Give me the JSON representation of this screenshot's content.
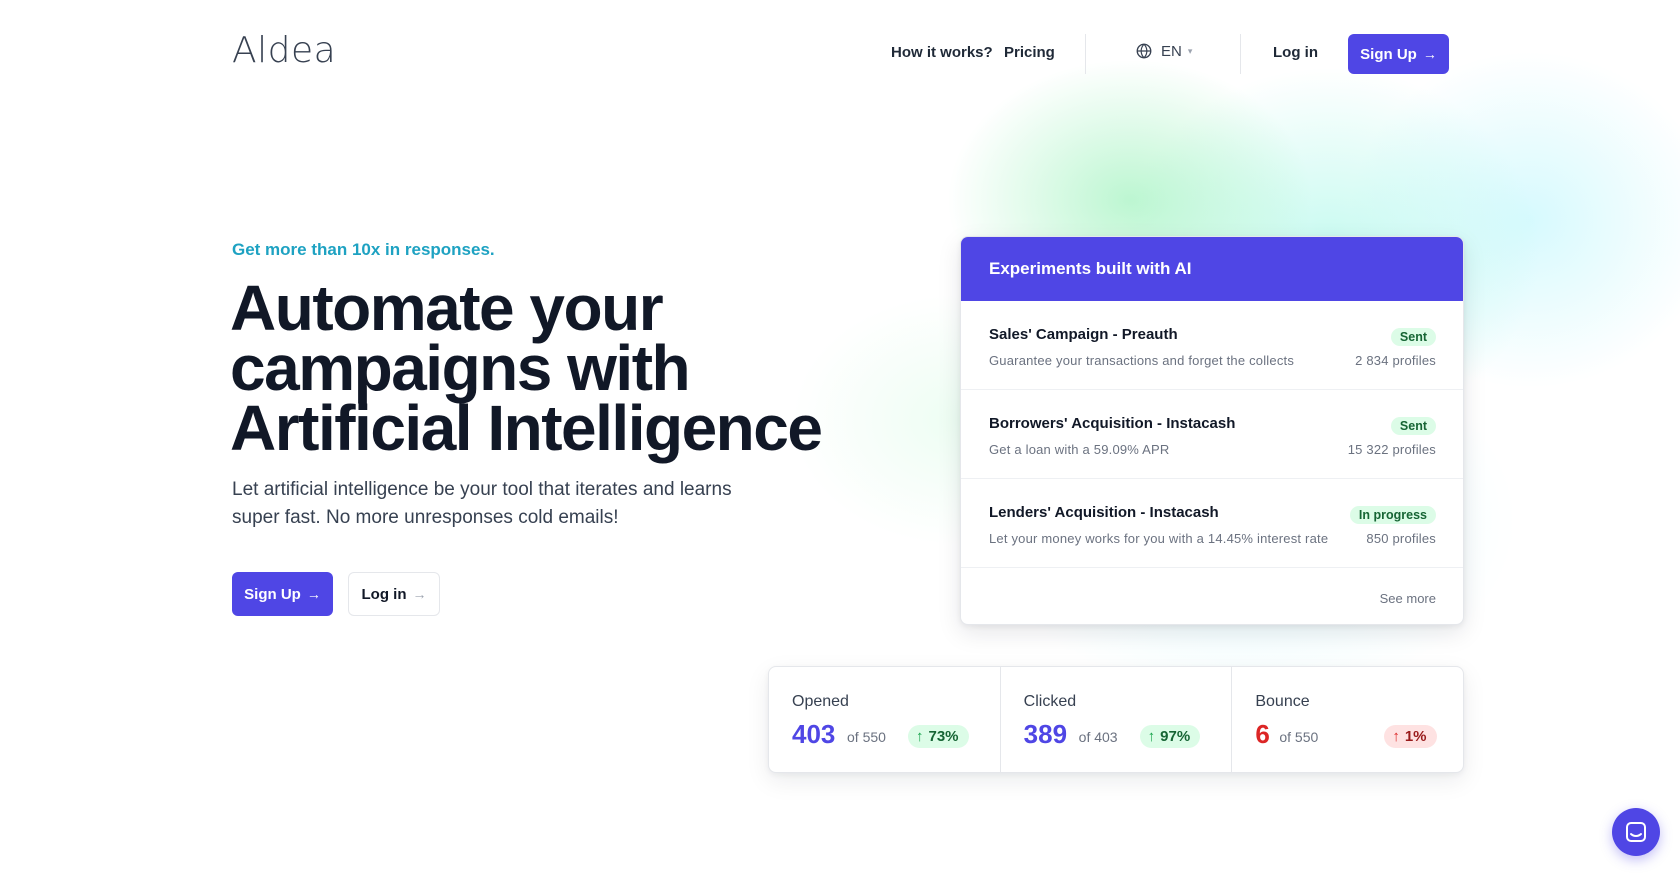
{
  "header": {
    "logo": "Aldea",
    "nav": {
      "how_it_works": "How it works?",
      "pricing": "Pricing"
    },
    "language": {
      "value": "EN",
      "icon": "globe-icon"
    },
    "login": "Log in",
    "signup": "Sign Up"
  },
  "hero": {
    "tagline": "Get more than 10x in responses.",
    "title_lines": [
      "Automate your",
      "campaigns with",
      "Artificial Intelligence"
    ],
    "subtitle_lines": [
      "Let artificial intelligence be your tool that iterates and learns",
      "super fast. No more unresponses cold emails!"
    ],
    "signup": "Sign Up",
    "login": "Log in",
    "arrow": "→"
  },
  "experiments": {
    "title": "Experiments built with AI",
    "items": [
      {
        "title": "Sales' Campaign - Preauth",
        "description": "Guarantee your transactions and forget the collects",
        "status": "Sent",
        "count": "2 834 profiles"
      },
      {
        "title": "Borrowers' Acquisition - Instacash",
        "description": "Get a loan with a 59.09% APR",
        "status": "Sent",
        "count": "15 322 profiles"
      },
      {
        "title": "Lenders' Acquisition - Instacash",
        "description": "Let your money works for you with a 14.45% interest rate",
        "status": "In progress",
        "count": "850 profiles"
      }
    ],
    "see_more": "See more"
  },
  "stats": [
    {
      "label": "Opened",
      "value": "403",
      "of": "of 550",
      "change": "73%",
      "trend": "up",
      "tone": "positive"
    },
    {
      "label": "Clicked",
      "value": "389",
      "of": "of 403",
      "change": "97%",
      "trend": "up",
      "tone": "positive"
    },
    {
      "label": "Bounce",
      "value": "6",
      "of": "of 550",
      "change": "1%",
      "trend": "up",
      "tone": "negative"
    }
  ],
  "chat": {
    "icon": "chat-icon"
  },
  "colors": {
    "accent": "#4f46e5",
    "tagline": "#1ea2c2",
    "positive": "#16a34a",
    "negative": "#dc2626"
  }
}
